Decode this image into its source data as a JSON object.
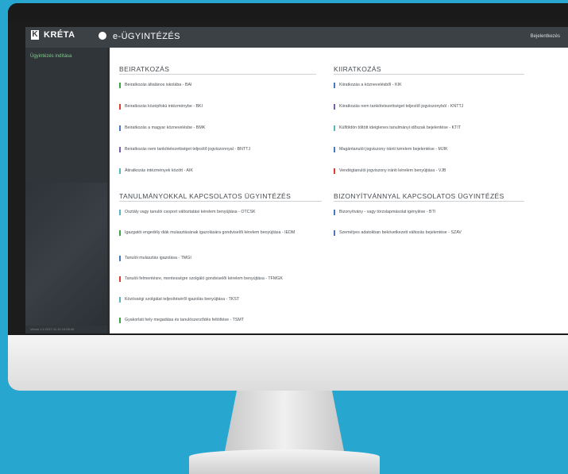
{
  "app": {
    "logo_mark": "K",
    "logo_text": "KRÉTA",
    "page_title": "e-ÜGYINTÉZÉS",
    "login_label": "Bejelentkezés"
  },
  "sidebar": {
    "active_item": "Ügyintézés indítása",
    "footer": "Verzió 1.0 2017.11.10 19:28:45"
  },
  "sections": {
    "beiratkozas": {
      "title": "BEIRATKOZÁS",
      "items": [
        {
          "label": "Beiratkozás általános iskolába - BAI",
          "color": "#3aa641"
        },
        {
          "label": "Beiratkozás középfokú intézménybe - BKI",
          "color": "#e03c31"
        },
        {
          "label": "Beiratkozás a magyar köznevelésbe - BMK",
          "color": "#4a78c5"
        },
        {
          "label": "Beiratkozás nem tankötelezettséget teljesítő jogviszonnyal - BNTTJ",
          "color": "#7b5ea7"
        },
        {
          "label": "Átiratkozás intézmények között - AIK",
          "color": "#57b2c4"
        }
      ]
    },
    "kiiratkozas": {
      "title": "KIIRATKOZÁS",
      "items": [
        {
          "label": "Kiiratkozás a köznevelésből - KIK",
          "color": "#4a78c5"
        },
        {
          "label": "Kiiratkozás nem tankötelezettséget teljesítő jogviszonyból - KNTTJ",
          "color": "#7b5ea7"
        },
        {
          "label": "Külföldön töltött ideiglenes tanulmányi időszak bejelentése - KTIT",
          "color": "#57b2c4"
        },
        {
          "label": "Magántanulói jogviszony iránti kérelem bejelentése - MJIK",
          "color": "#4a78c5"
        },
        {
          "label": "Vendégtanulói jogviszony iránti kérelem benyújtása - VJB",
          "color": "#e03c31"
        }
      ]
    },
    "tanulmanyok": {
      "title": "TANULMÁNYOKKAL KAPCSOLATOS ÜGYINTÉZÉS",
      "items": [
        {
          "label": "Osztály vagy tanulói csoport változtatási kérelem benyújtása - OTCSK",
          "color": "#57b2c4"
        },
        {
          "label": "Igazgatói engedély diák mulasztásának igazolására gondviselői kérelem beoyújtása - IEDM",
          "color": "#3aa641"
        },
        {
          "label": "Tanulói mulasztás igazolása - TMGI",
          "color": "#4a78c5"
        },
        {
          "label": "Tanulói felmentésre, mentességre szolgáló gondviselői kérelem benyújtása - TFMGK",
          "color": "#e03c31"
        },
        {
          "label": "Közösségi szolgálat teljesítéséről igazolás benyújtása - TKST",
          "color": "#57b2c4"
        },
        {
          "label": "Gyakorlati hely megadása és tanulószerződés feltöltése - TSMT",
          "color": "#3aa641"
        }
      ]
    },
    "bizonyitvany": {
      "title": "BIZONYÍTVÁNNYAL KAPCSOLATOS ÜGYINTÉZÉS",
      "items": [
        {
          "label": "Bizonyítvány - vagy törzslapmásolat igénylése - BTI",
          "color": "#4a78c5"
        },
        {
          "label": "Személyes adatokban bekövetkezett változás bejelentése - SZAV",
          "color": "#4a78c5"
        }
      ]
    }
  }
}
